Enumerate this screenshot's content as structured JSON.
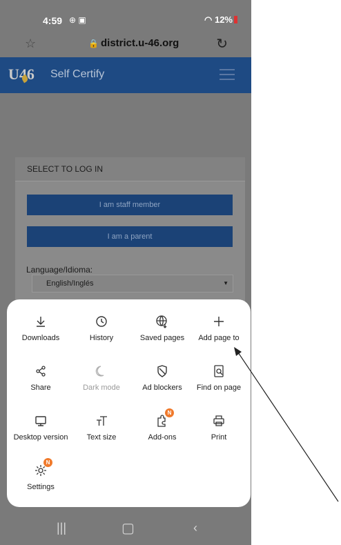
{
  "status_bar": {
    "time": "4:59",
    "battery": "12%"
  },
  "browser": {
    "url": "district.u-46.org"
  },
  "site": {
    "logo_text": "U46",
    "brand": "Self Certify",
    "card_title": "SELECT TO LOG IN",
    "staff_button": "I am staff member",
    "parent_button": "I am a parent",
    "language_label": "Language/Idioma:",
    "language_value": "English/Inglés"
  },
  "menu": {
    "items": [
      {
        "label": "Downloads",
        "icon": "download-icon"
      },
      {
        "label": "History",
        "icon": "history-icon"
      },
      {
        "label": "Saved pages",
        "icon": "saved-pages-icon"
      },
      {
        "label": "Add page to",
        "icon": "plus-icon"
      },
      {
        "label": "Share",
        "icon": "share-icon"
      },
      {
        "label": "Dark mode",
        "icon": "moon-icon",
        "disabled": true
      },
      {
        "label": "Ad blockers",
        "icon": "shield-icon"
      },
      {
        "label": "Find on page",
        "icon": "find-icon"
      },
      {
        "label": "Desktop version",
        "icon": "desktop-icon"
      },
      {
        "label": "Text size",
        "icon": "text-size-icon"
      },
      {
        "label": "Add-ons",
        "icon": "puzzle-icon",
        "badge": "N"
      },
      {
        "label": "Print",
        "icon": "printer-icon"
      },
      {
        "label": "Settings",
        "icon": "gear-icon",
        "badge": "N"
      }
    ]
  },
  "colors": {
    "appbar": "#1e4a83",
    "button": "#1b4276",
    "badge": "#f07a2c",
    "scrim": "#7a7a7a"
  }
}
